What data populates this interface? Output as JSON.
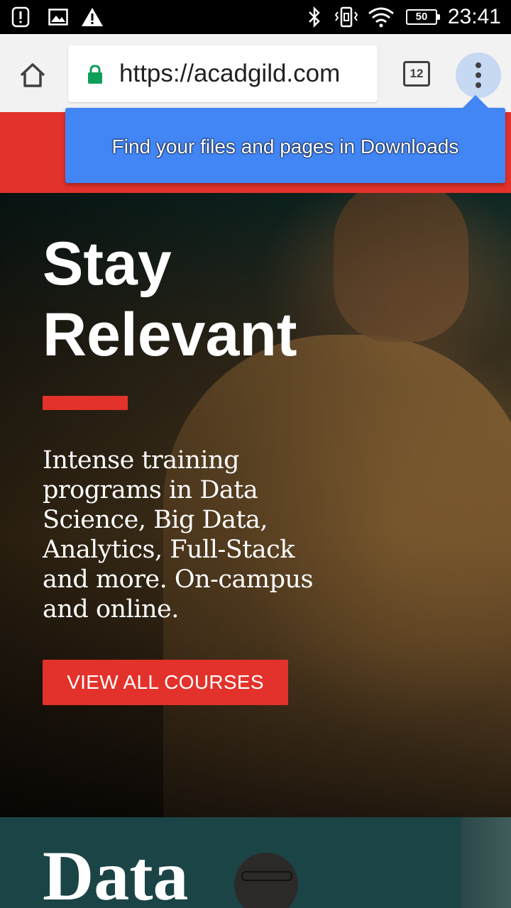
{
  "status_bar": {
    "time": "23:41",
    "battery_level": "50",
    "left_icons": [
      "alert-notification-icon",
      "image-icon",
      "warning-icon"
    ],
    "right_icons": [
      "bluetooth-icon",
      "vibrate-icon",
      "wifi-icon",
      "battery-icon"
    ]
  },
  "browser": {
    "url": "https://acadgild.com",
    "tab_count": "12",
    "secure": true,
    "accent_color": "#4285f4",
    "lock_color": "#0f9d58"
  },
  "tooltip": {
    "text": "Find your files and pages in Downloads"
  },
  "hero": {
    "title_line1": "Stay",
    "title_line2": "Relevant",
    "description": "Intense training programs in Data Science, Big Data, Analytics, Full-Stack and more. On-campus and online.",
    "cta_label": "VIEW ALL COURSES",
    "brand_color": "#e3322b"
  },
  "next_section": {
    "title": "Data"
  }
}
